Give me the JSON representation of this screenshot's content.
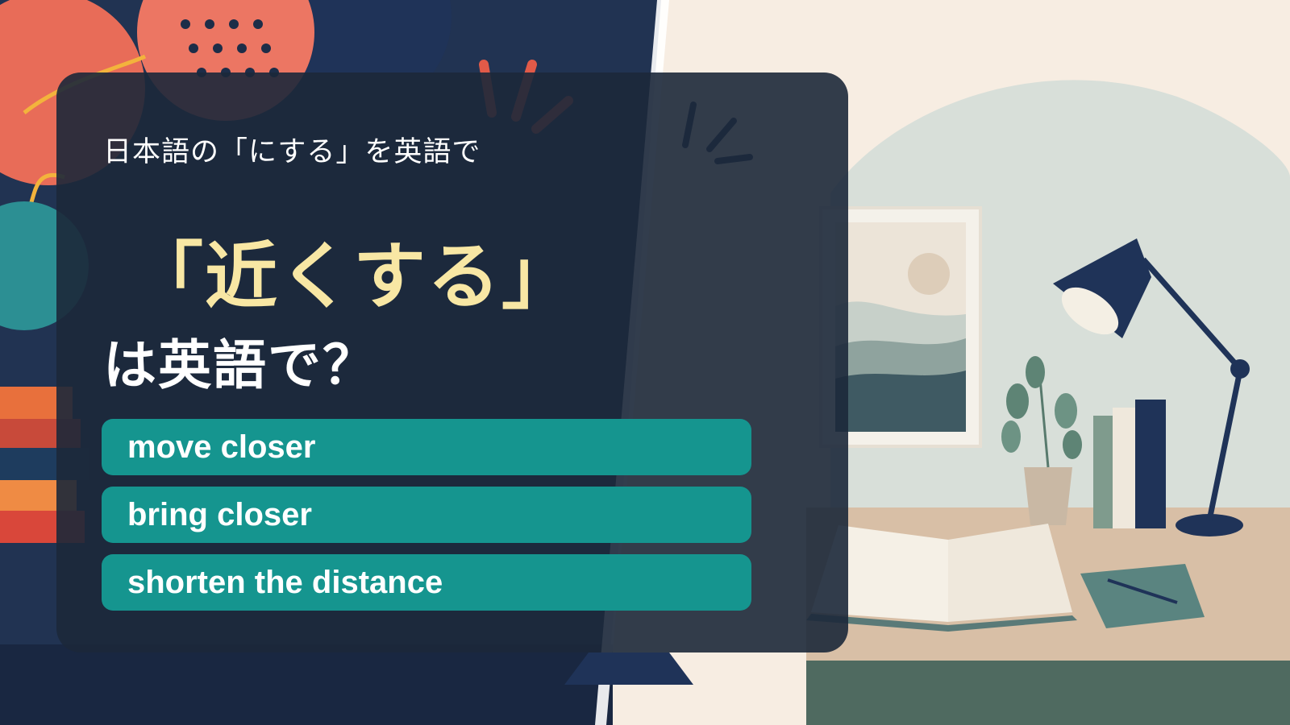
{
  "card": {
    "subtitle": "日本語の「にする」を英語で",
    "headline": "「近くする」",
    "question": "は英語で？"
  },
  "answers": [
    {
      "label": "move closer"
    },
    {
      "label": "bring closer"
    },
    {
      "label": "shorten the distance"
    }
  ],
  "colors": {
    "card_background": "#1c283a",
    "headline": "#f8e7a4",
    "answer_background": "#15958f",
    "text": "#ffffff"
  },
  "background": {
    "icons": [
      "desk-lamp-icon",
      "framed-picture-icon",
      "potted-plant-icon",
      "open-book-icon",
      "notebook-icon",
      "pencil-icon",
      "book-stack-icon"
    ]
  }
}
